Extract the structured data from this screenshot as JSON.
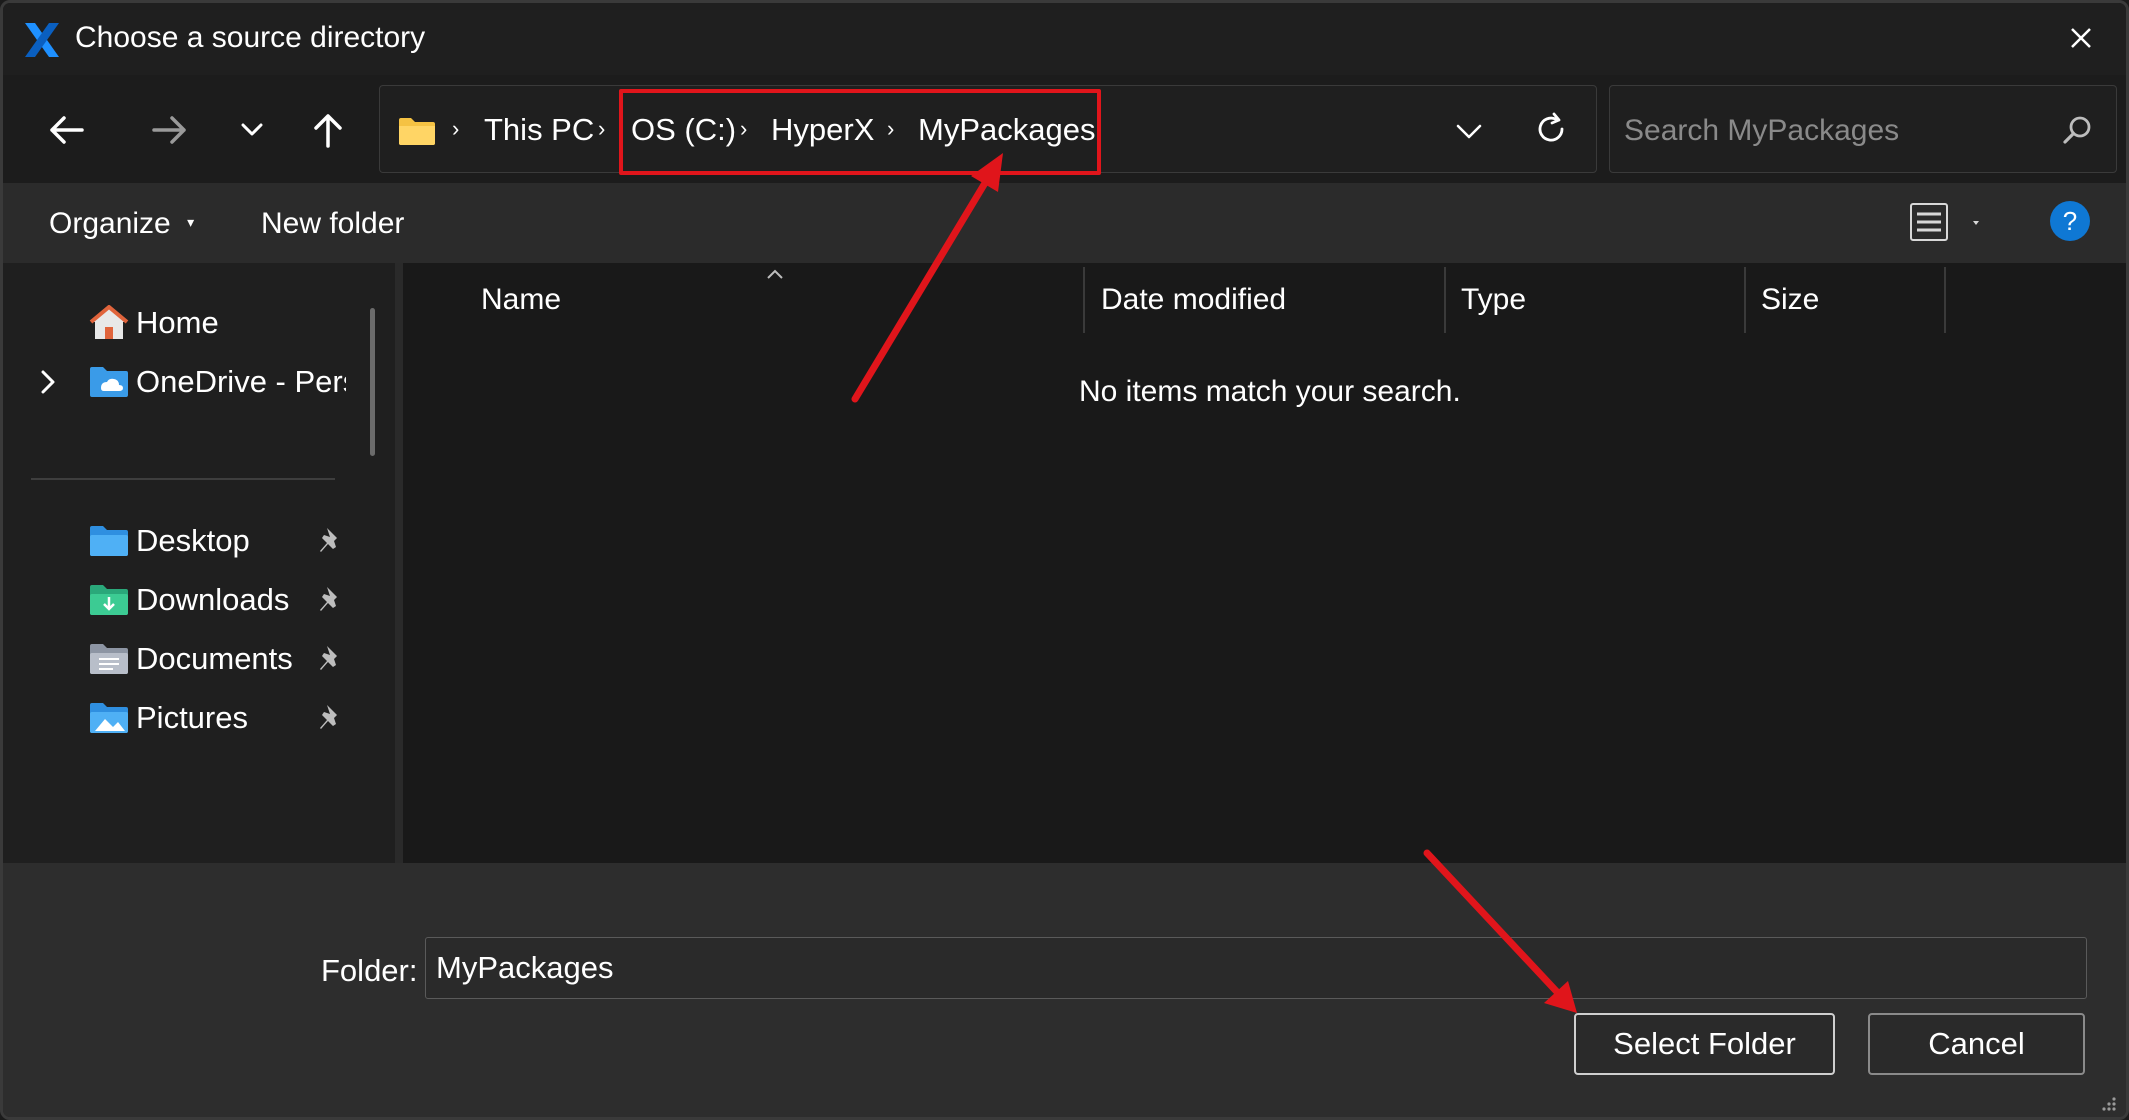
{
  "window": {
    "title": "Choose a source directory"
  },
  "navigation": {
    "back_icon": "arrow-left-icon",
    "forward_icon": "arrow-right-icon",
    "recent_icon": "chevron-down-icon",
    "up_icon": "arrow-up-icon"
  },
  "address_bar": {
    "crumbs": [
      "This PC",
      "OS (C:)",
      "HyperX",
      "MyPackages"
    ]
  },
  "search": {
    "placeholder": "Search MyPackages"
  },
  "command_bar": {
    "organize_label": "Organize",
    "new_folder_label": "New folder",
    "help_label": "?"
  },
  "sidebar": {
    "items": [
      {
        "label": "Home",
        "icon": "home-icon"
      },
      {
        "label": "OneDrive - Persc",
        "icon": "onedrive-folder-icon"
      },
      {
        "label": "Desktop",
        "icon": "desktop-folder-icon",
        "pinned": true
      },
      {
        "label": "Downloads",
        "icon": "downloads-folder-icon",
        "pinned": true
      },
      {
        "label": "Documents",
        "icon": "documents-folder-icon",
        "pinned": true
      },
      {
        "label": "Pictures",
        "icon": "pictures-folder-icon",
        "pinned": true
      }
    ]
  },
  "file_list": {
    "columns": [
      "Name",
      "Date modified",
      "Type",
      "Size"
    ],
    "empty_message": "No items match your search."
  },
  "footer": {
    "folder_label": "Folder:",
    "folder_value": "MyPackages",
    "select_button": "Select Folder",
    "cancel_button": "Cancel"
  },
  "colors": {
    "accent": "#0f78d4",
    "annotation": "#e0151b",
    "folder_yellow": "#f5c243"
  }
}
